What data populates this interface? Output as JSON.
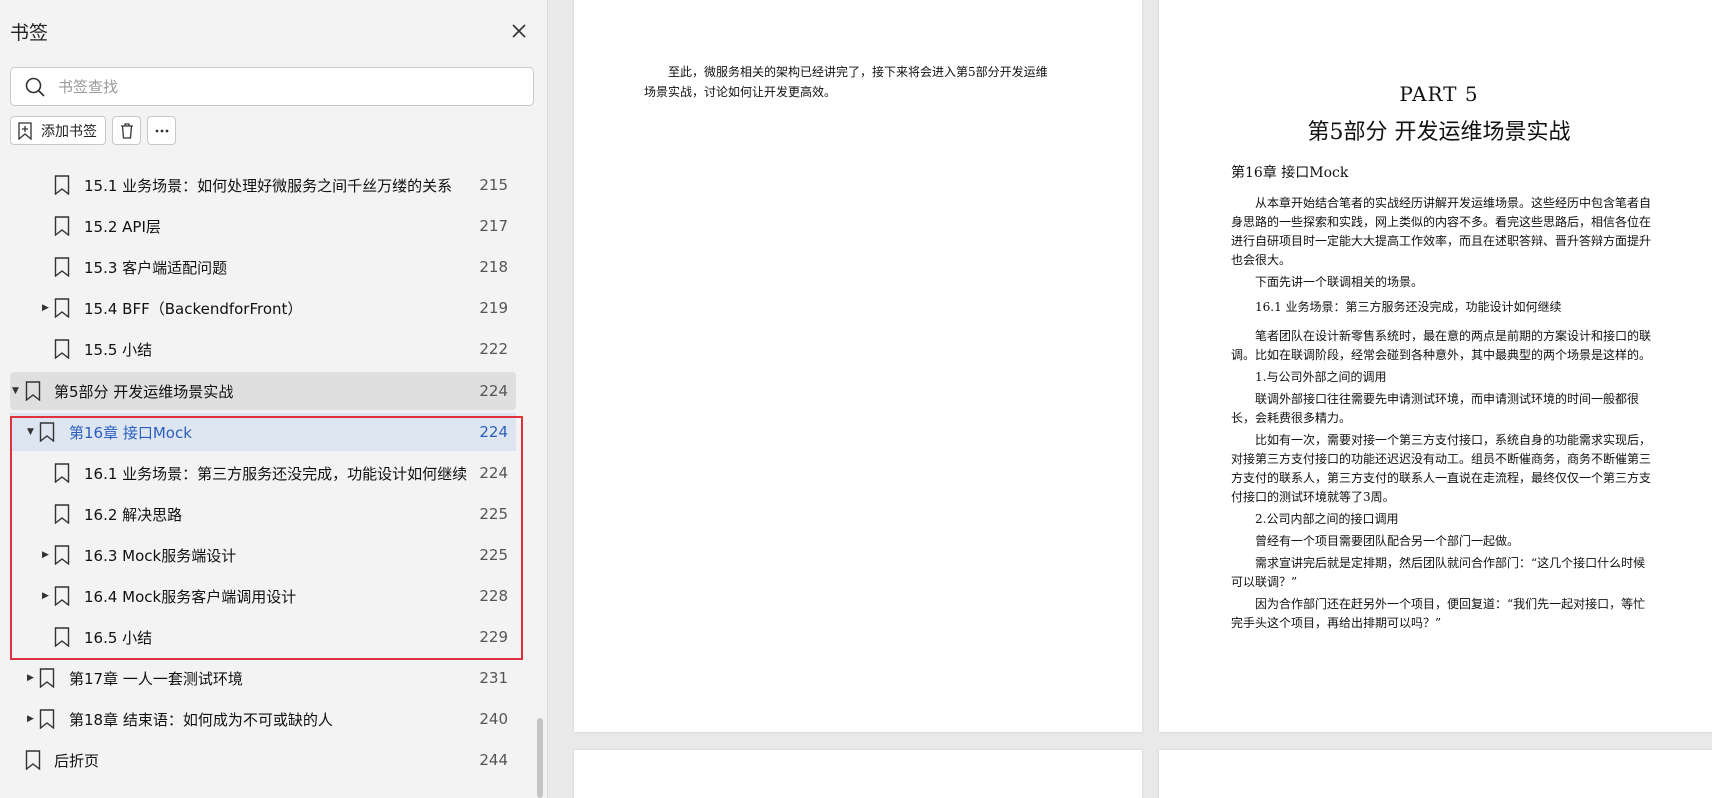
{
  "sidebar": {
    "title": "书签",
    "search_placeholder": "书签查找",
    "add_bookmark_label": "添加书签",
    "items": [
      {
        "label": "15.1 业务场景：如何处理好微服务之间千丝万缕的关系",
        "page": "215"
      },
      {
        "label": "15.2 API层",
        "page": "217"
      },
      {
        "label": "15.3 客户端适配问题",
        "page": "218"
      },
      {
        "label": "15.4 BFF（BackendforFront）",
        "page": "219"
      },
      {
        "label": "15.5 小结",
        "page": "222"
      },
      {
        "label": "第5部分 开发运维场景实战",
        "page": "224"
      },
      {
        "label": "第16章 接口Mock",
        "page": "224"
      },
      {
        "label": "16.1 业务场景：第三方服务还没完成，功能设计如何继续",
        "page": "224"
      },
      {
        "label": "16.2 解决思路",
        "page": "225"
      },
      {
        "label": "16.3 Mock服务端设计",
        "page": "225"
      },
      {
        "label": "16.4 Mock服务客户端调用设计",
        "page": "228"
      },
      {
        "label": "16.5 小结",
        "page": "229"
      },
      {
        "label": "第17章 一人一套测试环境",
        "page": "231"
      },
      {
        "label": "第18章 结束语：如何成为不可或缺的人",
        "page": "240"
      },
      {
        "label": "后折页",
        "page": "244"
      }
    ]
  },
  "document": {
    "page_left_text": "至此，微服务相关的架构已经讲完了，接下来将会进入第5部分开发运维场景实战，讨论如何让开发更高效。",
    "part_en": "PART 5",
    "part_cn": "第5部分 开发运维场景实战",
    "chapter": "第16章 接口Mock",
    "paragraphs": [
      "从本章开始结合笔者的实战经历讲解开发运维场景。这些经历中包含笔者自身思路的一些探索和实践，网上类似的内容不多。看完这些思路后，相信各位在进行自研项目时一定能大大提高工作效率，而且在述职答辩、晋升答辩方面提升也会很大。",
      "下面先讲一个联调相关的场景。",
      "16.1 业务场景：第三方服务还没完成，功能设计如何继续",
      "笔者团队在设计新零售系统时，最在意的两点是前期的方案设计和接口的联调。比如在联调阶段，经常会碰到各种意外，其中最典型的两个场景是这样的。",
      "1.与公司外部之间的调用",
      "联调外部接口往往需要先申请测试环境，而申请测试环境的时间一般都很长，会耗费很多精力。",
      "比如有一次，需要对接一个第三方支付接口，系统自身的功能需求实现后，对接第三方支付接口的功能还迟迟没有动工。组员不断催商务，商务不断催第三方支付的联系人，第三方支付的联系人一直说在走流程，最终仅仅一个第三方支付接口的测试环境就等了3周。",
      "2.公司内部之间的接口调用",
      "曾经有一个项目需要团队配合另一个部门一起做。",
      "需求宣讲完后就是定排期，然后团队就问合作部门：“这几个接口什么时候可以联调？”",
      "因为合作部门还在赶另外一个项目，便回复道：“我们先一起对接口，等忙完手头这个项目，再给出排期可以吗？”"
    ]
  },
  "colors": {
    "selected_text": "#2a5fbf",
    "highlight_border": "#e0323c"
  }
}
